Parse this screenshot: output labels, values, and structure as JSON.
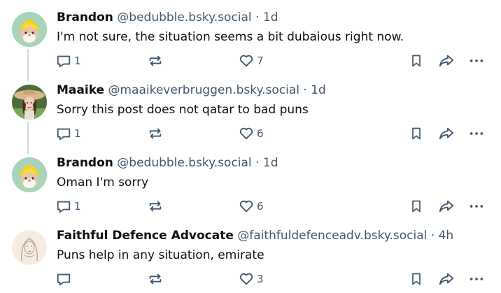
{
  "posts": [
    {
      "author_name": "Brandon",
      "handle": "@bedubble.bsky.social",
      "time": "1d",
      "text": "I'm not sure, the situation seems a bit dubaious right now.",
      "reply_count": "1",
      "like_count": "7",
      "avatar": "gnome-avatar"
    },
    {
      "author_name": "Maaike",
      "handle": "@maaikeverbruggen.bsky.social",
      "time": "1d",
      "text": "Sorry this post does not qatar to bad puns",
      "reply_count": "1",
      "like_count": "6",
      "avatar": "sunhat-portrait-avatar"
    },
    {
      "author_name": "Brandon",
      "handle": "@bedubble.bsky.social",
      "time": "1d",
      "text": "Oman I'm sorry",
      "reply_count": "1",
      "like_count": "6",
      "avatar": "gnome-avatar"
    },
    {
      "author_name": "Faithful Defence Advocate",
      "handle": "@faithfuldefenceadv.bsky.social",
      "time": "4h",
      "text": "Puns help in any situation, emirate",
      "reply_count": "",
      "like_count": "3",
      "avatar": "line-drawing-avatar"
    }
  ],
  "separator": "·",
  "colors": {
    "text": "#0b0f14",
    "muted": "#42576c",
    "thread_line": "#d4dbe2"
  }
}
